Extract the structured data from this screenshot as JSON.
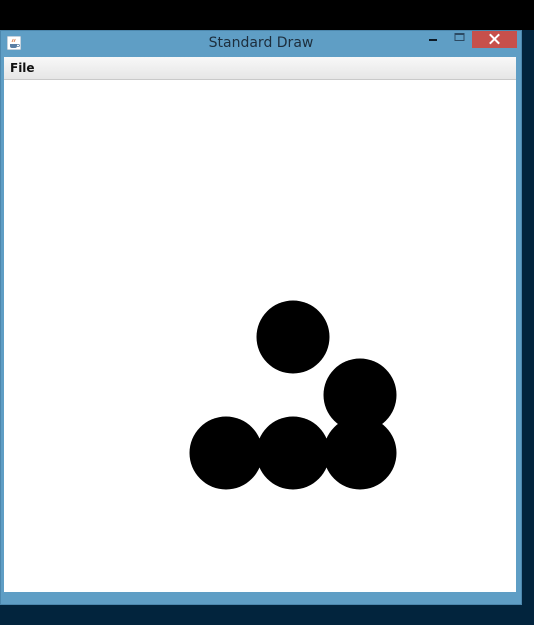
{
  "window": {
    "title": "Standard Draw",
    "app_icon": "java-coffee-cup-icon",
    "controls": {
      "minimize_icon": "minimize-icon",
      "maximize_icon": "maximize-icon",
      "close_icon": "close-icon",
      "close_color": "#c7504b"
    }
  },
  "menubar": {
    "items": [
      {
        "label": "File"
      }
    ]
  },
  "canvas": {
    "background": "#ffffff",
    "shape_color": "#000000",
    "circles": 5
  }
}
